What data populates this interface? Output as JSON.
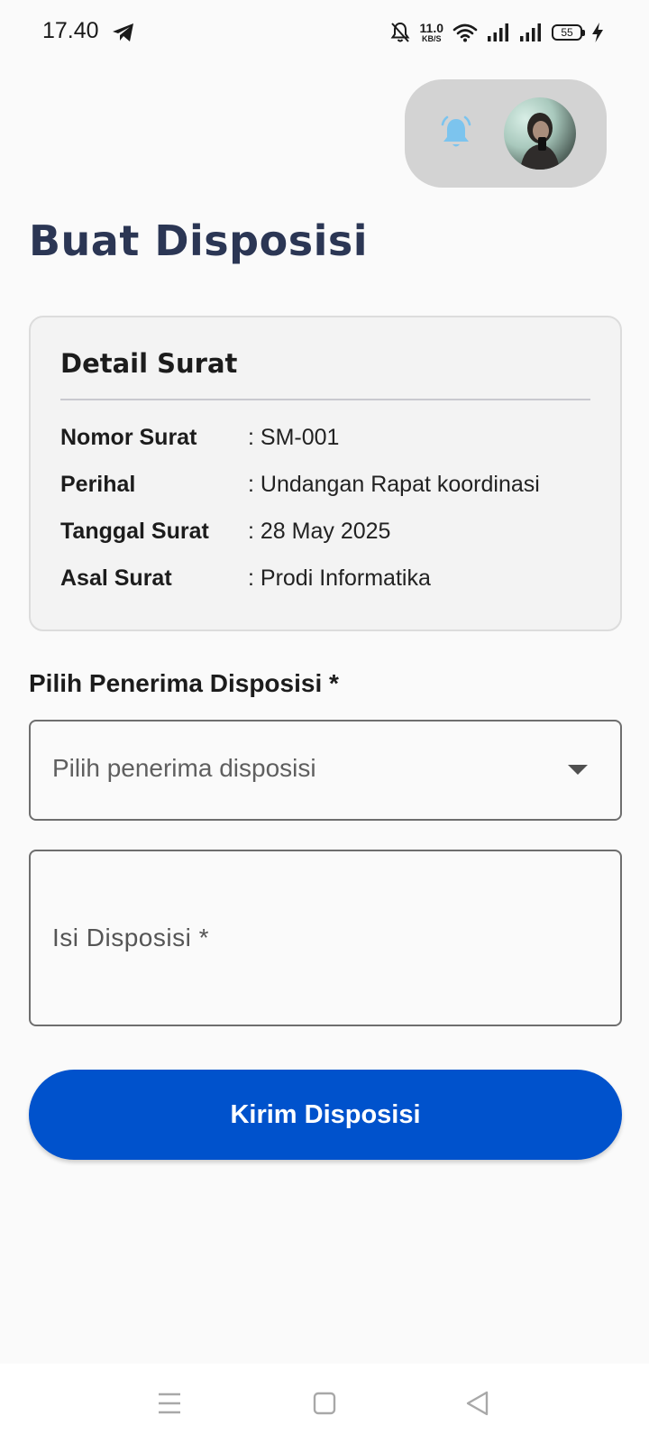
{
  "status_bar": {
    "time": "17.40",
    "net_speed_value": "11.0",
    "net_speed_unit": "KB/S",
    "battery_level": "55",
    "icons": [
      "telegram-icon",
      "mute-bell-icon",
      "wifi-icon",
      "signal-icon",
      "signal-icon",
      "battery-icon",
      "charging-icon"
    ]
  },
  "header": {
    "notification_icon": "bell-icon",
    "avatar_icon": "user-avatar"
  },
  "page": {
    "title": "Buat Disposisi"
  },
  "detail_card": {
    "title": "Detail Surat",
    "rows": [
      {
        "label": "Nomor Surat",
        "value": ": SM-001"
      },
      {
        "label": "Perihal",
        "value": ": Undangan Rapat koordinasi"
      },
      {
        "label": "Tanggal Surat",
        "value": ": 28 May 2025"
      },
      {
        "label": "Asal Surat",
        "value": ": Prodi Informatika"
      }
    ]
  },
  "form": {
    "recipient_label": "Pilih Penerima Disposisi *",
    "recipient_placeholder": "Pilih penerima disposisi",
    "isi_label": "Isi Disposisi *",
    "submit_label": "Kirim Disposisi"
  },
  "nav_bar": {
    "icons": [
      "menu-icon",
      "home-icon",
      "back-icon"
    ]
  },
  "colors": {
    "background": "#fafafa",
    "title": "#2b3654",
    "primary_button": "#0052cc",
    "header_pill": "#d3d3d3",
    "bell": "#7cc4ee",
    "card_bg": "#f3f3f3"
  }
}
